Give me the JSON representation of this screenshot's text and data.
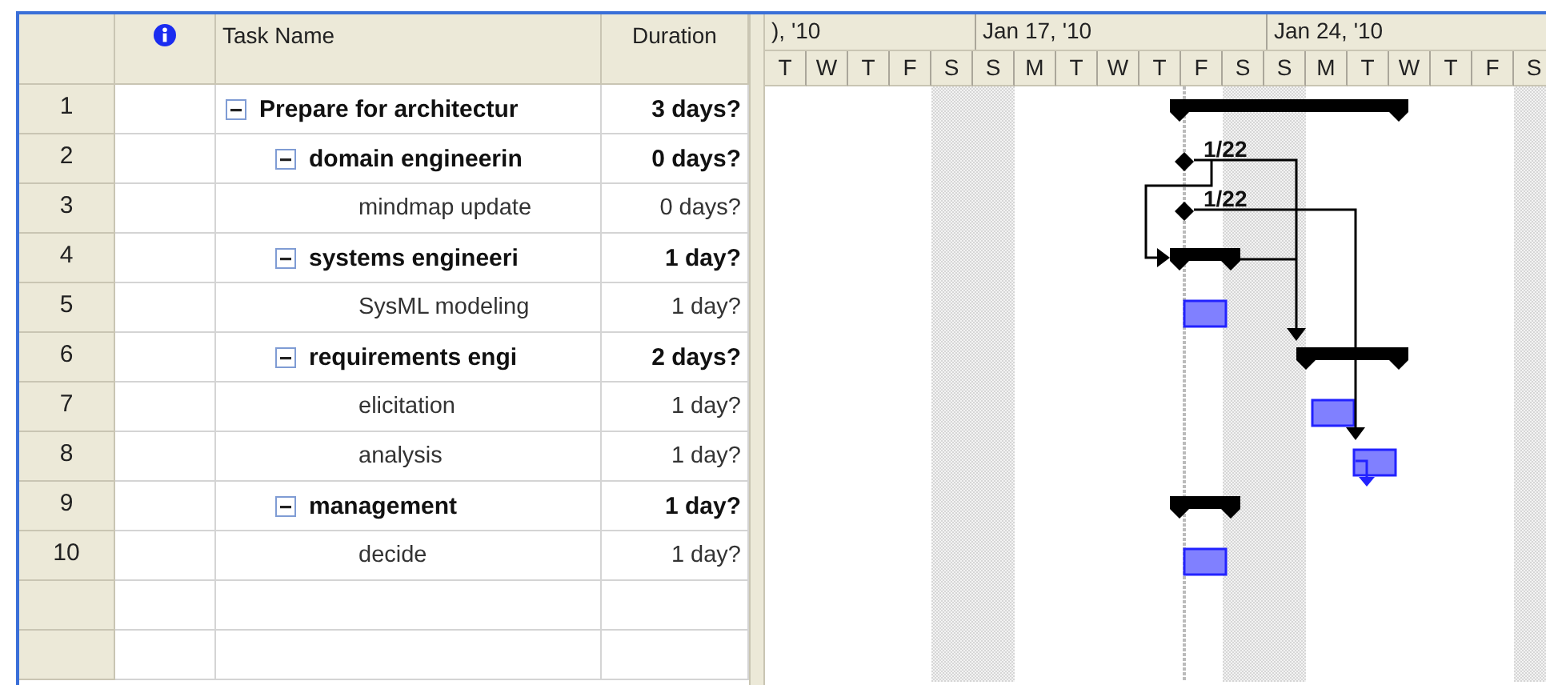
{
  "table": {
    "headers": {
      "task_name": "Task Name",
      "duration": "Duration"
    },
    "tasks": [
      {
        "id": "1",
        "name": "Prepare for architectur",
        "duration": "3 days?",
        "kind": "summary",
        "expanded": true,
        "children": [
          {
            "id": "2",
            "name": "domain engineerin",
            "duration": "0 days?",
            "kind": "milestone",
            "milestone_label": "1/22",
            "expanded": true,
            "children": [
              {
                "id": "3",
                "name": "mindmap update",
                "duration": "0 days?",
                "kind": "milestone",
                "milestone_label": "1/22"
              }
            ]
          },
          {
            "id": "4",
            "name": "systems engineeri",
            "duration": "1 day?",
            "kind": "summary",
            "expanded": true,
            "children": [
              {
                "id": "5",
                "name": "SysML modeling",
                "duration": "1 day?",
                "kind": "task"
              }
            ]
          },
          {
            "id": "6",
            "name": "requirements engi",
            "duration": "2 days?",
            "kind": "summary",
            "expanded": true,
            "children": [
              {
                "id": "7",
                "name": "elicitation",
                "duration": "1 day?",
                "kind": "task"
              },
              {
                "id": "8",
                "name": "analysis",
                "duration": "1 day?",
                "kind": "task"
              }
            ]
          },
          {
            "id": "9",
            "name": "management",
            "duration": "1 day?",
            "kind": "summary",
            "expanded": true,
            "children": [
              {
                "id": "10",
                "name": "decide",
                "duration": "1 day?",
                "kind": "task"
              }
            ]
          }
        ]
      }
    ]
  },
  "timescale": {
    "weeks": [
      "), '10",
      "Jan 17, '10",
      "Jan 24, '10"
    ],
    "days": [
      {
        "label": "T",
        "nonworking": false
      },
      {
        "label": "W",
        "nonworking": false
      },
      {
        "label": "T",
        "nonworking": false
      },
      {
        "label": "F",
        "nonworking": false
      },
      {
        "label": "S",
        "nonworking": true
      },
      {
        "label": "S",
        "nonworking": true
      },
      {
        "label": "M",
        "nonworking": false
      },
      {
        "label": "T",
        "nonworking": false
      },
      {
        "label": "W",
        "nonworking": false
      },
      {
        "label": "T",
        "nonworking": false
      },
      {
        "label": "F",
        "nonworking": false
      },
      {
        "label": "S",
        "nonworking": true
      },
      {
        "label": "S",
        "nonworking": true
      },
      {
        "label": "M",
        "nonworking": false
      },
      {
        "label": "T",
        "nonworking": false
      },
      {
        "label": "W",
        "nonworking": false
      },
      {
        "label": "T",
        "nonworking": false
      },
      {
        "label": "F",
        "nonworking": false
      },
      {
        "label": "S",
        "nonworking": true
      }
    ]
  }
}
